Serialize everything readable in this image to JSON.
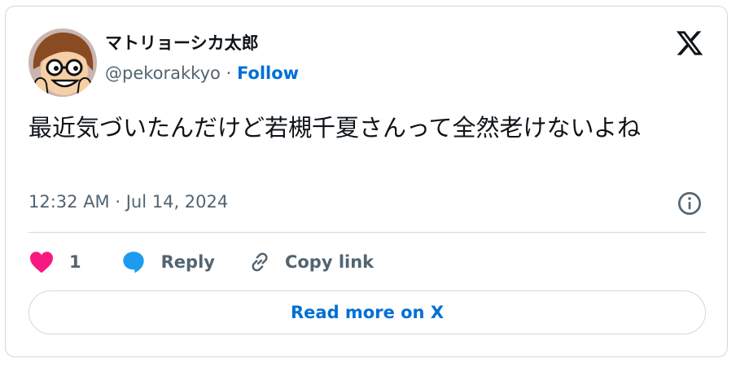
{
  "author": {
    "display_name": "マトリョーシカ太郎",
    "handle": "@pekorakkyo",
    "separator": "·",
    "follow_label": "Follow"
  },
  "tweet": {
    "text": "最近気づいたんだけど若槻千夏さんって全然老けないよね",
    "timestamp": "12:32 AM · Jul 14, 2024"
  },
  "actions": {
    "like_count": "1",
    "reply_label": "Reply",
    "copy_link_label": "Copy link"
  },
  "footer": {
    "read_more_label": "Read more on X"
  },
  "icons": {
    "brand": "x-logo-icon",
    "info": "info-icon",
    "like": "heart-icon",
    "reply": "speech-bubble-icon",
    "copy": "link-icon"
  },
  "colors": {
    "text_primary": "#0f1419",
    "text_secondary": "#536471",
    "link": "#006fd6",
    "like": "#f91880",
    "reply": "#1d9bf0",
    "border": "#cfd9de"
  }
}
